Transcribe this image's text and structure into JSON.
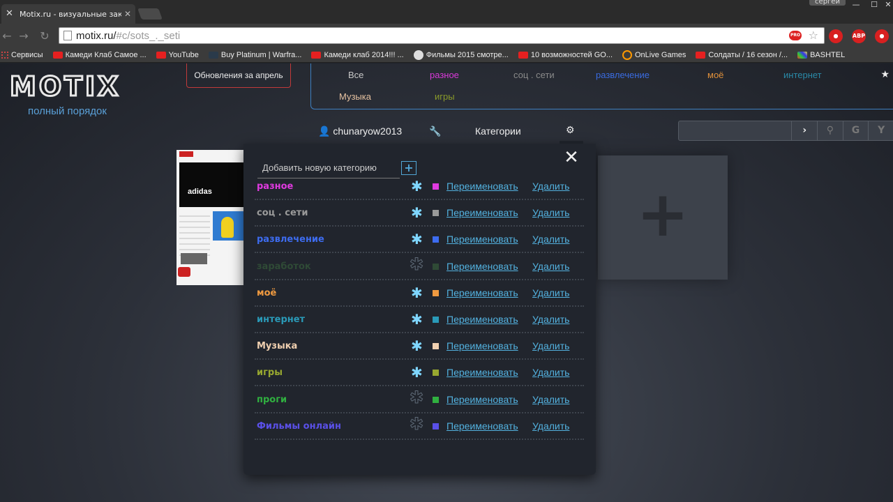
{
  "browser": {
    "tab_title": "Motix.ru - визуальные закл",
    "profile_name": "сергей",
    "url_host": "motix.ru/",
    "url_path": "#c/sots_._seti",
    "bookmarks": [
      {
        "label": "Сервисы",
        "icon": "apps-grid-icon"
      },
      {
        "label": "Камеди Клаб Самое ...",
        "icon": "youtube-icon"
      },
      {
        "label": "YouTube",
        "icon": "youtube-icon"
      },
      {
        "label": "Buy Platinum | Warfra...",
        "icon": "warframe-icon"
      },
      {
        "label": "Камеди клаб 2014!!! ...",
        "icon": "youtube-icon"
      },
      {
        "label": "Фильмы 2015 смотре...",
        "icon": "skull-icon"
      },
      {
        "label": "10 возможностей GO...",
        "icon": "youtube-icon"
      },
      {
        "label": "OnLive Games",
        "icon": "onlive-icon"
      },
      {
        "label": "Солдаты / 16 сезон /...",
        "icon": "youtube-icon"
      },
      {
        "label": "BASHTEL",
        "icon": "bashtel-icon"
      }
    ]
  },
  "site": {
    "logo_text": "MOTIX",
    "tagline": "полный порядок",
    "updates_button": "Обновления за апрель",
    "nav": [
      {
        "label": "Все",
        "color": "#c8c8c8"
      },
      {
        "label": "разное",
        "color": "#d93ad9"
      },
      {
        "label": "соц . сети",
        "color": "#8a8a8a"
      },
      {
        "label": "развлечение",
        "color": "#3a6be0"
      },
      {
        "label": "моё",
        "color": "#e0903a"
      },
      {
        "label": "интернет",
        "color": "#2a8aa8"
      },
      {
        "label": "Музыка",
        "color": "#e6c2a0"
      },
      {
        "label": "игры",
        "color": "#8a9a2a"
      }
    ],
    "user": {
      "username": "chunaryow2013",
      "categories_label": "Категории"
    }
  },
  "modal": {
    "add_category_placeholder": "Добавить новую категорию",
    "rename_label": "Переименовать",
    "delete_label": "Удалить",
    "categories": [
      {
        "name": "разное",
        "color": "#e03ae0",
        "favorite": true
      },
      {
        "name": "соц . сети",
        "color": "#9a9a9a",
        "favorite": true
      },
      {
        "name": "развлечение",
        "color": "#3d6cf0",
        "favorite": true
      },
      {
        "name": "заработок",
        "color": "#2f4a36",
        "favorite": false
      },
      {
        "name": "моё",
        "color": "#f09a40",
        "favorite": true
      },
      {
        "name": "интернет",
        "color": "#2a9ab8",
        "favorite": true
      },
      {
        "name": "Музыка",
        "color": "#f0d0b0",
        "favorite": true
      },
      {
        "name": "игры",
        "color": "#98a830",
        "favorite": true
      },
      {
        "name": "проги",
        "color": "#30b040",
        "favorite": false
      },
      {
        "name": "Фильмы онлайн",
        "color": "#5a50e8",
        "favorite": false
      }
    ]
  },
  "colors": {
    "link": "#53b2e0",
    "accent_blue": "#3e7fc0",
    "updates_border": "#c23a3a"
  }
}
